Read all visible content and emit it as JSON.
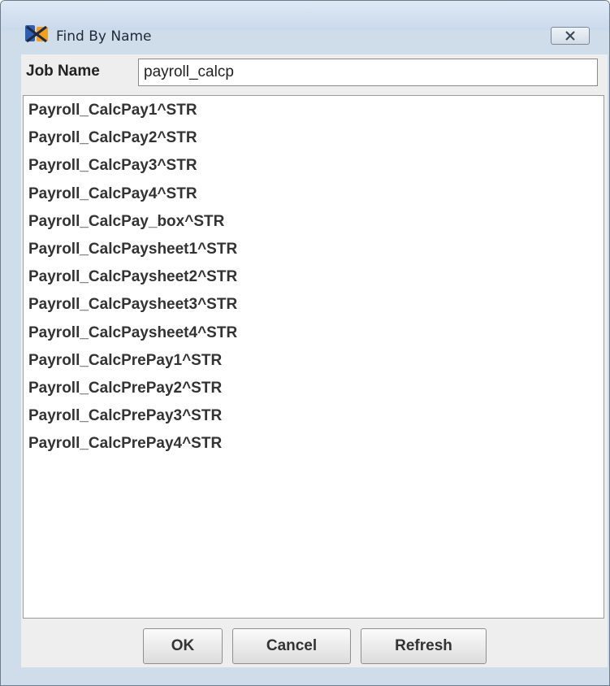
{
  "window": {
    "title": "Find By Name",
    "icon": "job-scheduler-app-icon",
    "close_icon": "close-x-icon"
  },
  "search": {
    "label": "Job Name",
    "value": "payroll_calcp"
  },
  "results": [
    "Payroll_CalcPay1^STR",
    "Payroll_CalcPay2^STR",
    "Payroll_CalcPay3^STR",
    "Payroll_CalcPay4^STR",
    "Payroll_CalcPay_box^STR",
    "Payroll_CalcPaysheet1^STR",
    "Payroll_CalcPaysheet2^STR",
    "Payroll_CalcPaysheet3^STR",
    "Payroll_CalcPaysheet4^STR",
    "Payroll_CalcPrePay1^STR",
    "Payroll_CalcPrePay2^STR",
    "Payroll_CalcPrePay3^STR",
    "Payroll_CalcPrePay4^STR"
  ],
  "buttons": {
    "ok": "OK",
    "cancel": "Cancel",
    "refresh": "Refresh"
  },
  "colors": {
    "titlebar": "#cfdcea",
    "dialog_bg": "#eeeeee",
    "list_bg": "#ffffff"
  }
}
